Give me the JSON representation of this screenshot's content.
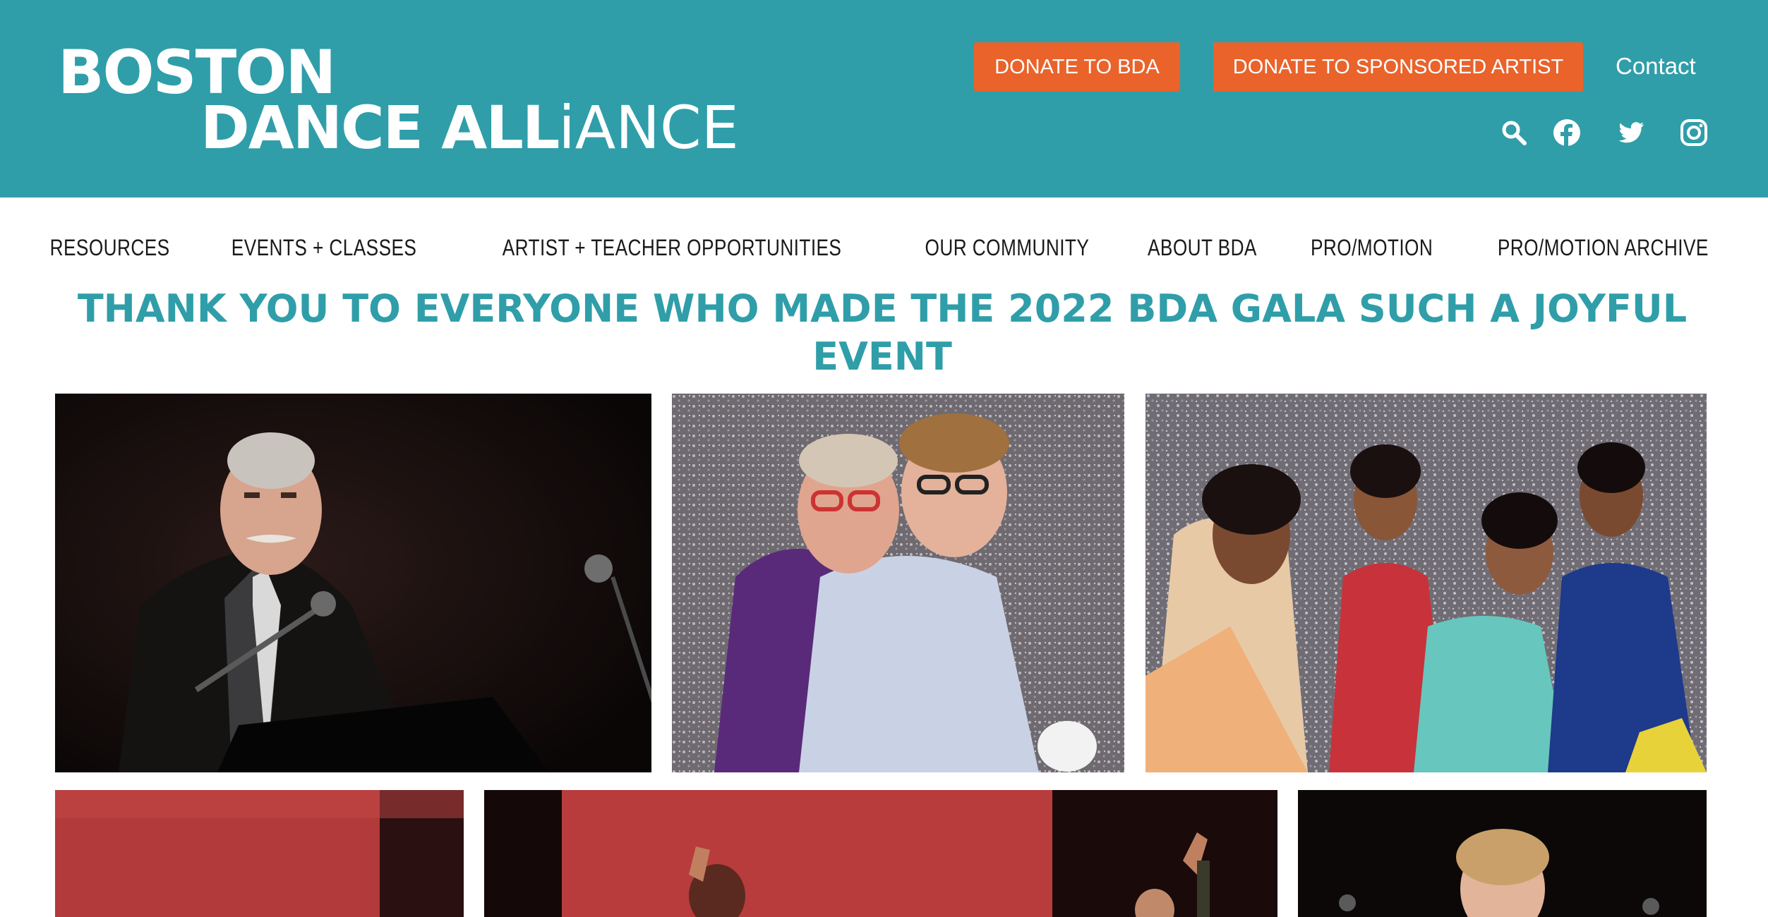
{
  "header": {
    "logo_line1": "BOSTON",
    "logo_line2_bold": "DANCE ALL",
    "logo_line2_thin": "iANCE",
    "donate_bda": "DONATE TO BDA",
    "donate_artist": "DONATE TO SPONSORED ARTIST",
    "contact": "Contact",
    "social_icons": [
      "search-icon",
      "facebook-icon",
      "twitter-icon",
      "instagram-icon"
    ]
  },
  "nav": {
    "items": [
      "RESOURCES",
      "EVENTS + CLASSES",
      "ARTIST + TEACHER OPPORTUNITIES",
      "OUR COMMUNITY",
      "ABOUT BDA",
      "PRO/MOTION",
      "PRO/MOTION ARCHIVE"
    ]
  },
  "page": {
    "title": "THANK YOU TO EVERYONE WHO MADE THE 2022 BDA GALA SUCH A JOYFUL EVENT"
  },
  "colors": {
    "brand_teal": "#2f9ea9",
    "donate_orange": "#e9632b"
  }
}
